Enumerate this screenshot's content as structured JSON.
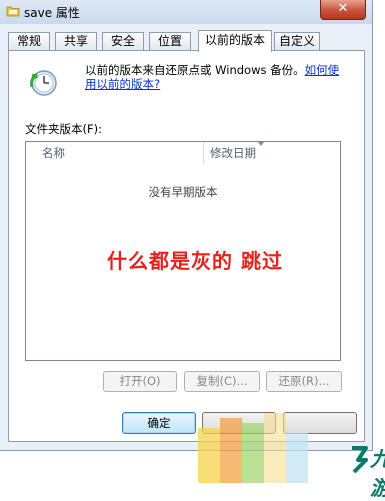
{
  "window": {
    "title": "save 属性",
    "close_glyph": "✕"
  },
  "tabs": [
    {
      "label": "常规",
      "active": false
    },
    {
      "label": "共享",
      "active": false
    },
    {
      "label": "安全",
      "active": false
    },
    {
      "label": "位置",
      "active": false
    },
    {
      "label": "以前的版本",
      "active": true
    },
    {
      "label": "自定义",
      "active": false
    }
  ],
  "panel": {
    "info_text_1": "以前的版本来自还原点或 Windows 备份。",
    "info_link": "如何使用以前的版本?",
    "folder_versions_label": "文件夹版本(F):",
    "columns": [
      "名称",
      "修改日期"
    ],
    "empty_message": "没有早期版本",
    "overlay_annotation": "什么都是灰的 跳过",
    "buttons": {
      "open": "打开(O)",
      "copy": "复制(C)...",
      "restore": "还原(R)..."
    }
  },
  "footer": {
    "ok": "确定",
    "cancel": "",
    "apply": ""
  },
  "watermark": {
    "logo_text": "九游"
  },
  "colors": {
    "annotation": "#e4231b",
    "link": "#0033cc",
    "close_button": "#c7533c"
  },
  "icons": {
    "title": "folder-icon",
    "restore": "clock-restore-icon",
    "close": "close-icon"
  }
}
